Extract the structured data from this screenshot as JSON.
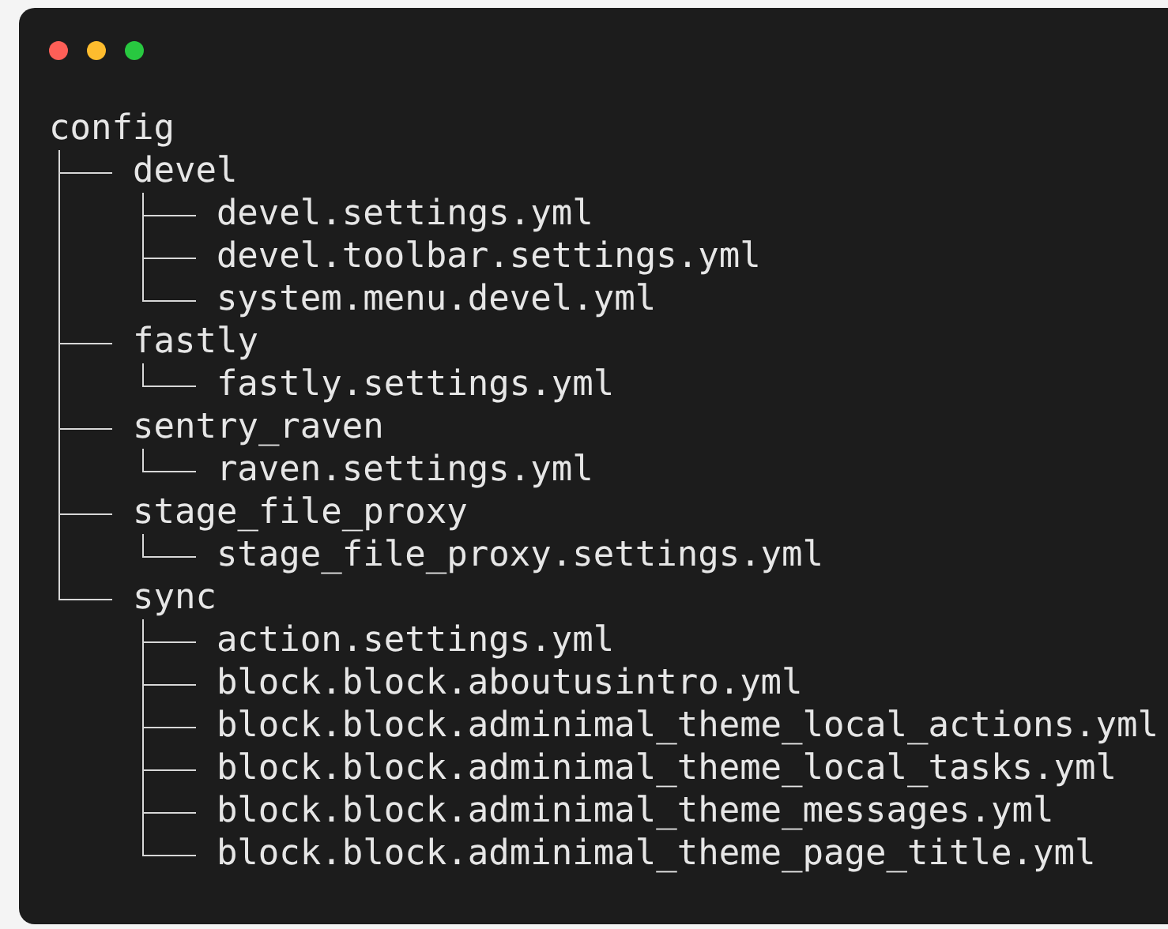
{
  "tree": {
    "name": "config",
    "children": [
      {
        "name": "devel",
        "children": [
          {
            "name": "devel.settings.yml"
          },
          {
            "name": "devel.toolbar.settings.yml"
          },
          {
            "name": "system.menu.devel.yml"
          }
        ]
      },
      {
        "name": "fastly",
        "children": [
          {
            "name": "fastly.settings.yml"
          }
        ]
      },
      {
        "name": "sentry_raven",
        "children": [
          {
            "name": "raven.settings.yml"
          }
        ]
      },
      {
        "name": "stage_file_proxy",
        "children": [
          {
            "name": "stage_file_proxy.settings.yml"
          }
        ]
      },
      {
        "name": "sync",
        "children": [
          {
            "name": "action.settings.yml"
          },
          {
            "name": "block.block.aboutusintro.yml"
          },
          {
            "name": "block.block.adminimal_theme_local_actions.yml"
          },
          {
            "name": "block.block.adminimal_theme_local_tasks.yml"
          },
          {
            "name": "block.block.adminimal_theme_messages.yml"
          },
          {
            "name": "block.block.adminimal_theme_page_title.yml"
          }
        ]
      }
    ]
  }
}
